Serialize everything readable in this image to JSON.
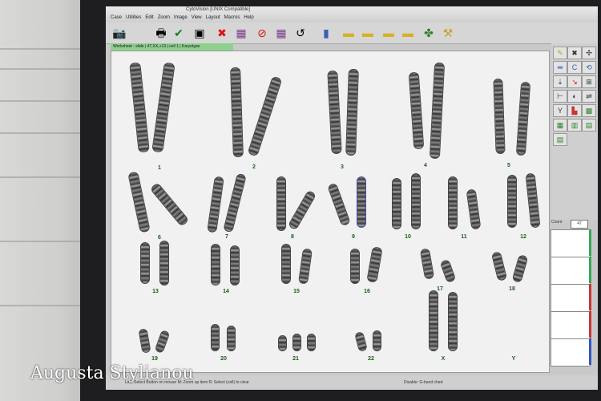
{
  "app": {
    "title": "CytoVision [UNIX Compatible]",
    "menu": [
      "Case",
      "Utilities",
      "Edit",
      "Zoom",
      "Image",
      "View",
      "Layout",
      "Macros",
      "Help"
    ]
  },
  "status_tab": "Worksheet - slide | 47,XX,+13 | cell 1 | Karyotype",
  "toolbar_icons": [
    "camera-icon",
    "printer-icon",
    "check-icon",
    "save-icon",
    "close-x-icon",
    "grid-icon",
    "no-icon",
    "grid-purple-icon",
    "undo-icon",
    "bar-chart-icon",
    "folder-icon",
    "folder-open-icon",
    "folder-icon-2",
    "folder-icon-3",
    "network-icon",
    "wand-icon"
  ],
  "chromosome_labels": [
    "1",
    "2",
    "3",
    "4",
    "5",
    "6",
    "7",
    "8",
    "9",
    "10",
    "11",
    "12",
    "13",
    "14",
    "15",
    "16",
    "17",
    "18",
    "19",
    "20",
    "21",
    "22",
    "X",
    "Y"
  ],
  "count": {
    "label": "Count",
    "value": "47"
  },
  "bottom_bar": {
    "left": "Left: Select Button on mouse   M: Zoom up item   R: Select (cell) to clear",
    "right": "Disable: G-band chart"
  },
  "colors": {
    "label_green": "#1c5d1c",
    "status_green": "#8fd08f"
  },
  "watermark": "Augusta Stylianou"
}
